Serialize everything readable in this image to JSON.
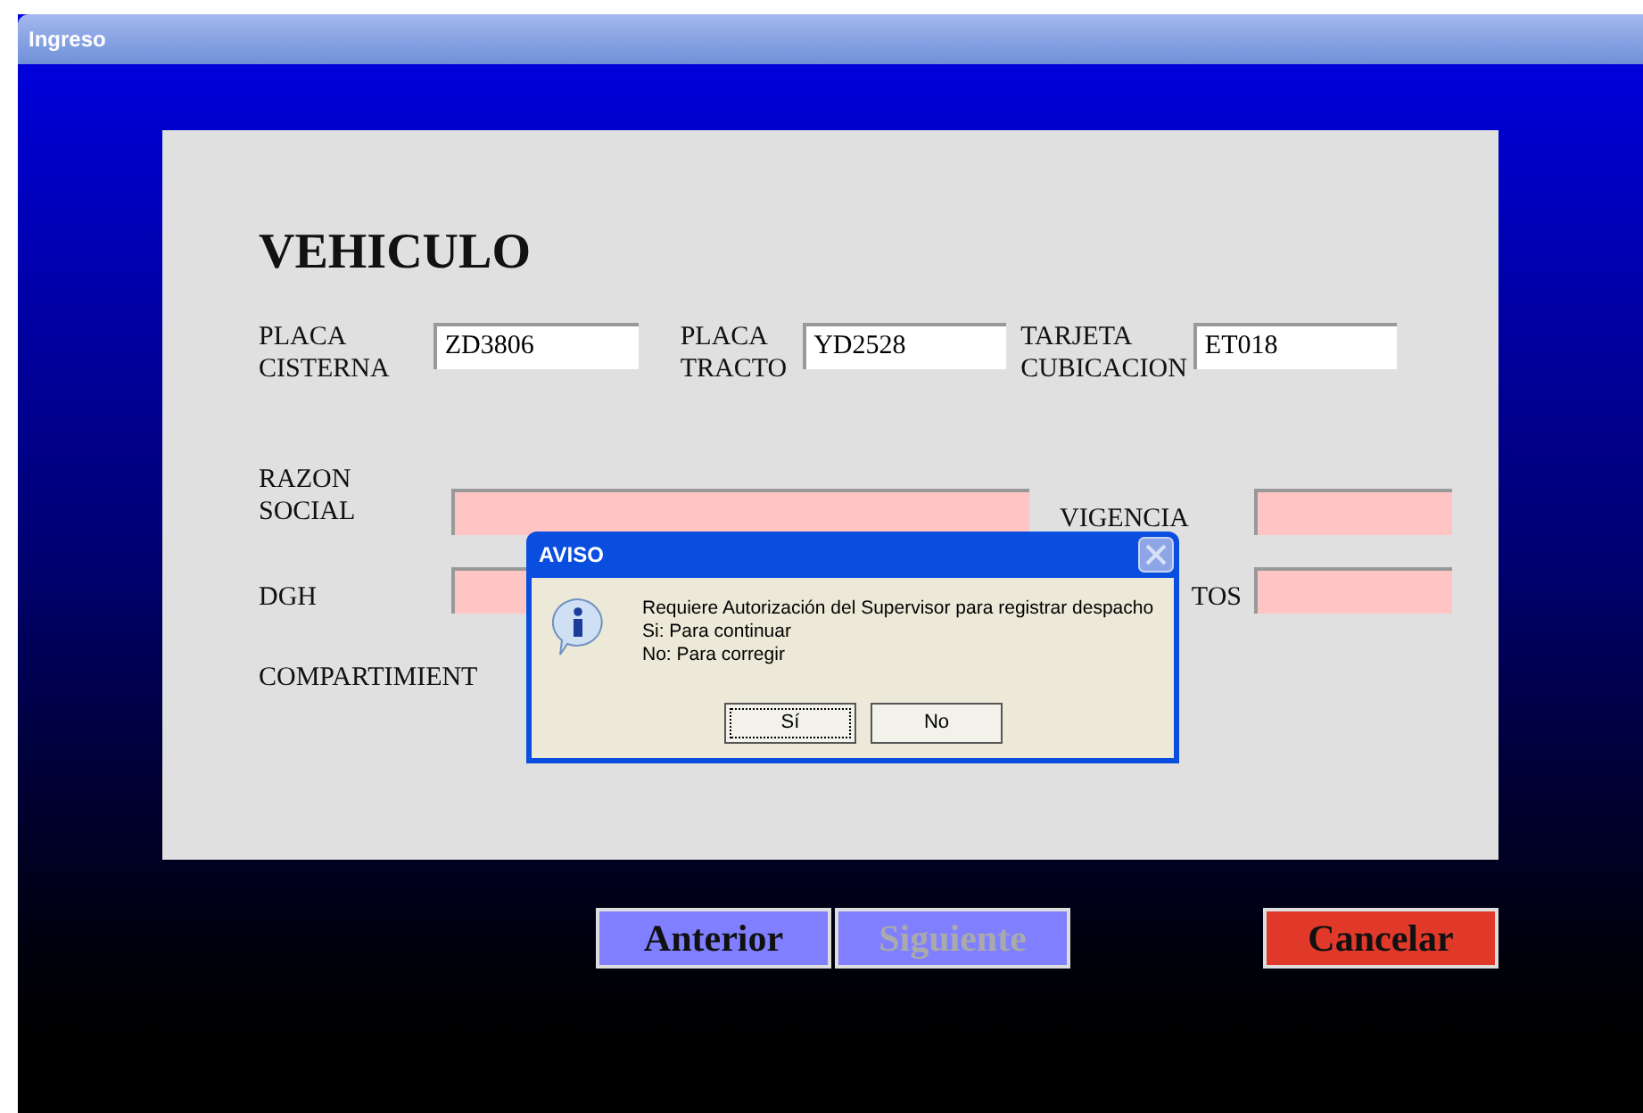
{
  "window": {
    "title": "Ingreso"
  },
  "form": {
    "heading": "VEHICULO",
    "row_1": [
      {
        "label": [
          "PLACA",
          "CISTERNA"
        ],
        "value": "ZD3806"
      },
      {
        "label": [
          "PLACA",
          "TRACTO"
        ],
        "value": "YD2528"
      },
      {
        "label": [
          "TARJETA",
          "CUBICACION"
        ],
        "value": "ET018"
      }
    ],
    "razon_social": {
      "label": [
        "RAZON",
        "SOCIAL"
      ]
    },
    "vigencia": {
      "label": "VIGENCIA"
    },
    "dgh": {
      "label": "DGH"
    },
    "column_3_label": "TOS",
    "compartimiento": {
      "label": "COMPARTIMIENT"
    }
  },
  "dialog": {
    "title": "AVISO",
    "lines": [
      "Requiere Autorización del Supervisor para registrar despacho",
      "Si: Para continuar",
      "No: Para corregir"
    ],
    "buttons": [
      {
        "label": "Sí",
        "selected": true
      },
      {
        "label": "No",
        "selected": false
      }
    ]
  },
  "buttons": [
    {
      "label": "Anterior",
      "kind": "nav",
      "disabled": false
    },
    {
      "label": "Siguiente",
      "kind": "nav",
      "disabled": true
    },
    {
      "label": "Cancelar",
      "kind": "cancel",
      "disabled": false
    }
  ]
}
